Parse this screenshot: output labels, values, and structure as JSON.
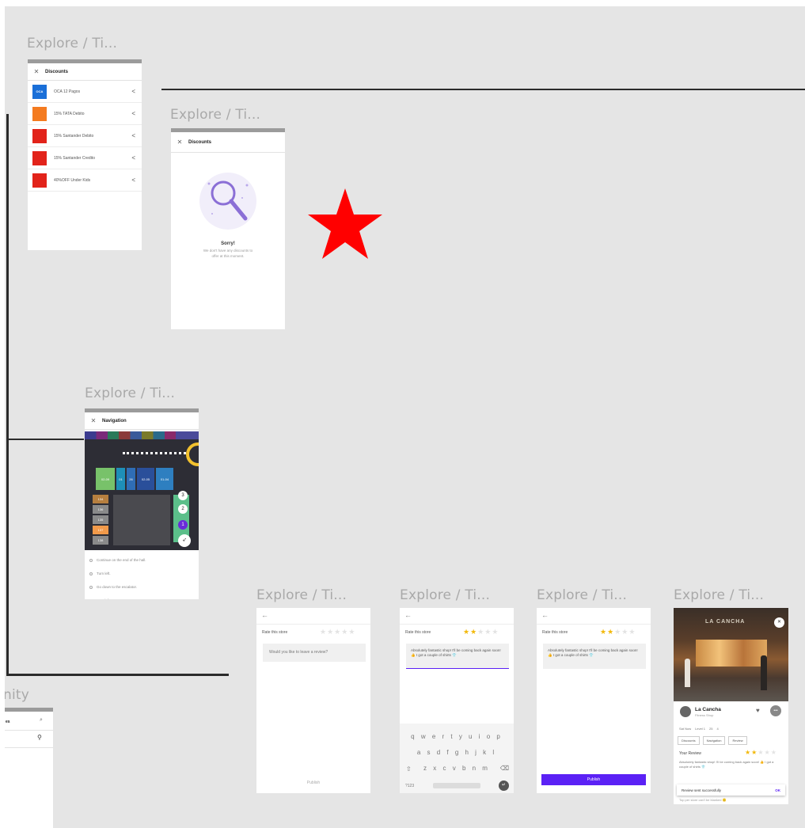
{
  "frames": {
    "discounts_list": {
      "title": "Explore / Ti...",
      "header": "Discounts",
      "items": [
        {
          "label": "OCA 12 Pagos",
          "logo_text": "OCA",
          "logo_color": "#1a6fd8"
        },
        {
          "label": "15% TATA Debito",
          "logo_text": "",
          "logo_color": "#f47b20"
        },
        {
          "label": "15% Santander Debito",
          "logo_text": "",
          "logo_color": "#e2231a"
        },
        {
          "label": "15% Santander Credito",
          "logo_text": "",
          "logo_color": "#e2231a"
        },
        {
          "label": "40%OFF Under Kids",
          "logo_text": "",
          "logo_color": "#e2231a"
        }
      ]
    },
    "discounts_empty": {
      "title": "Explore / Ti...",
      "header": "Discounts",
      "empty_title": "Sorry!",
      "empty_text_1": "We don't have any discounts to",
      "empty_text_2": "offer at this moment."
    },
    "navigation": {
      "title": "Explore / Ti...",
      "header": "Navigation",
      "steps": [
        "Continue on the end of the hall.",
        "Turn left.",
        "Go down to the escalator.",
        "Turn left."
      ],
      "map_cells": [
        "02-09",
        "01",
        "26",
        "02-05",
        "01-04",
        "134",
        "136",
        "135",
        "137",
        "138"
      ]
    },
    "rate_empty": {
      "title": "Explore / Ti...",
      "prompt": "Rate this store",
      "placeholder": "Would you like to leave a review?",
      "button": "Publish",
      "rating": 0
    },
    "rate_keyboard": {
      "title": "Explore / Ti...",
      "prompt": "Rate this store",
      "review_text": "Absolutely fantastic shop! I'll be coming back again soon! 👍 I got a couple of shirts 👕",
      "keyboard_row1": "q w e r t y u i o p",
      "keyboard_row2": "a s d f g h j k l",
      "keyboard_row3": "z x c v b n m",
      "keyboard_sym": "?123",
      "rating": 2
    },
    "rate_filled": {
      "title": "Explore / Ti...",
      "prompt": "Rate this store",
      "review_text": "Absolutely fantastic shop! I'll be coming back again soon! 👍 I got a couple of shirts 👕",
      "button": "Publish",
      "rating": 2
    },
    "store_detail": {
      "title": "Explore / Ti...",
      "photo_sign": "LA CANCHA",
      "store_name": "La Cancha",
      "store_category": "Fitness Shop",
      "meta": [
        "Sat Now",
        "Level 1",
        "25",
        "4"
      ],
      "chips": [
        "Discounts",
        "Navigation",
        "Review"
      ],
      "your_review_label": "Your Review",
      "your_rating": 2,
      "review_snippet": "Absolutely fantastic shop! I'll be coming back again soon! 👍 I got a couple of shirts 👕",
      "toast": "Review sent successfully",
      "toast_action": "OK",
      "footer": "Top per store can't be blanked 🙂"
    },
    "community": {
      "title": "nity",
      "tab_label": "es"
    }
  },
  "colors": {
    "accent": "#5b21f5",
    "star_marker": "#ff0000",
    "star_rating": "#f2b90c",
    "canvas": "#e5e5e5",
    "frame_title": "#a9a9a9"
  }
}
